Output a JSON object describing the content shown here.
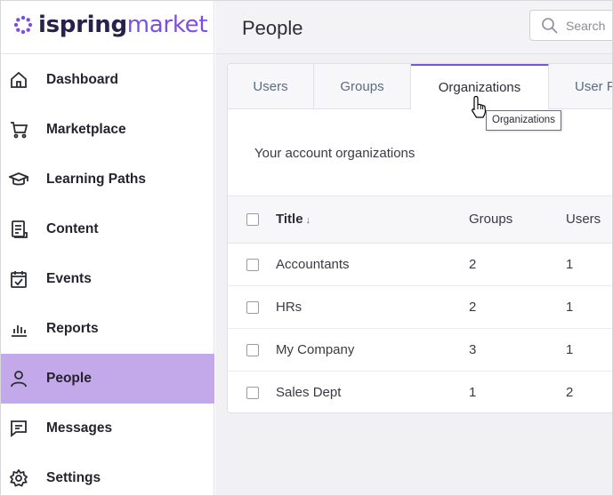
{
  "brand": {
    "part1": "ispring",
    "part2": "market",
    "accent": "#7d4fe0"
  },
  "sidebar": {
    "items": [
      {
        "label": "Dashboard",
        "icon": "home-icon"
      },
      {
        "label": "Marketplace",
        "icon": "cart-icon"
      },
      {
        "label": "Learning Paths",
        "icon": "graduation-cap-icon"
      },
      {
        "label": "Content",
        "icon": "document-icon"
      },
      {
        "label": "Events",
        "icon": "calendar-check-icon"
      },
      {
        "label": "Reports",
        "icon": "bar-chart-icon"
      },
      {
        "label": "People",
        "icon": "person-icon",
        "active": true
      },
      {
        "label": "Messages",
        "icon": "message-icon"
      },
      {
        "label": "Settings",
        "icon": "gear-icon"
      }
    ],
    "active_color": "#c3a9ea"
  },
  "header": {
    "title": "People",
    "search_placeholder": "Search"
  },
  "tabs": [
    {
      "label": "Users"
    },
    {
      "label": "Groups"
    },
    {
      "label": "Organizations",
      "active": true
    },
    {
      "label": "User P"
    }
  ],
  "main": {
    "subtitle": "Your account organizations"
  },
  "table": {
    "columns": [
      "Title",
      "Groups",
      "Users"
    ],
    "sort_icon": "↓",
    "rows": [
      {
        "title": "Accountants",
        "groups": "2",
        "users": "1"
      },
      {
        "title": "HRs",
        "groups": "2",
        "users": "1"
      },
      {
        "title": "My Company",
        "groups": "3",
        "users": "1"
      },
      {
        "title": "Sales Dept",
        "groups": "1",
        "users": "2"
      }
    ]
  },
  "tooltip": {
    "text": "Organizations"
  }
}
